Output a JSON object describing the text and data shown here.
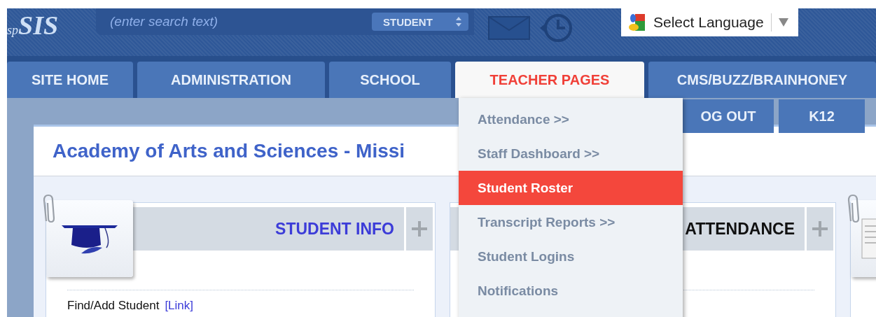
{
  "header": {
    "logo": {
      "prefix": "sp",
      "name": "SIS"
    },
    "search": {
      "placeholder": "(enter search text)"
    },
    "search_scope": "STUDENT",
    "language": {
      "label": "Select Language"
    }
  },
  "tabs": [
    {
      "label": "SITE HOME",
      "selected": false
    },
    {
      "label": "ADMINISTRATION",
      "selected": false
    },
    {
      "label": "SCHOOL",
      "selected": false
    },
    {
      "label": "TEACHER PAGES",
      "selected": true
    },
    {
      "label": "CMS/BUZZ/BRAINHONEY",
      "selected": false
    }
  ],
  "subnav": [
    "OG OUT",
    "K12"
  ],
  "card": {
    "title": "Academy of Arts and Sciences - Missi"
  },
  "panels": [
    {
      "title": "STUDENT INFO",
      "kind": "link",
      "tile": {
        "kind": "cap"
      },
      "rows": [
        {
          "label": "Find/Add Student",
          "link": "[Link]"
        }
      ]
    },
    {
      "title": "ATTENDANCE",
      "kind": "plain"
    },
    {
      "kind": "none",
      "tile": {
        "kind": "page"
      }
    }
  ],
  "menu": {
    "items": [
      {
        "label": "Attendance >>",
        "selected": false
      },
      {
        "label": "Staff Dashboard >>",
        "selected": false
      },
      {
        "label": "Student Roster",
        "selected": true
      },
      {
        "label": "Transcript Reports >>",
        "selected": false
      },
      {
        "label": "Student Logins",
        "selected": false
      },
      {
        "label": "Notifications",
        "selected": false
      }
    ]
  }
}
